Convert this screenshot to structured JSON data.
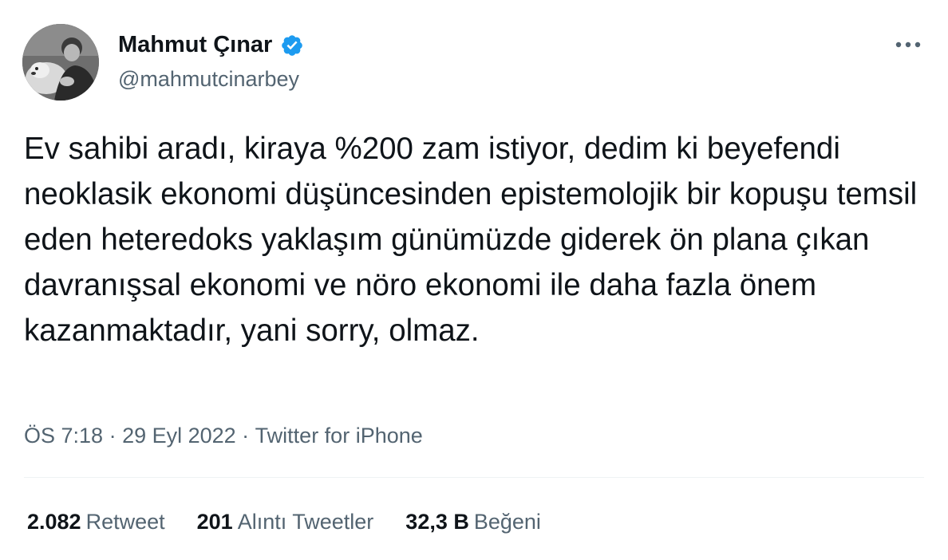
{
  "author": {
    "display_name": "Mahmut Çınar",
    "handle": "@mahmutcinarbey",
    "verified_icon": "verified-badge-icon",
    "avatar": "profile-photo-with-dog"
  },
  "more_icon": "more-horizontal-icon",
  "tweet": {
    "text": "Ev sahibi aradı, kiraya %200 zam istiyor, dedim ki beyefendi neoklasik ekonomi düşüncesinden epistemolojik bir kopuşu temsil eden heteredoks yaklaşım günümüzde giderek ön plana çıkan davranışsal ekonomi ve nöro ekonomi ile daha fazla önem kazanmaktadır, yani sorry, olmaz."
  },
  "meta": {
    "time": "ÖS 7:18",
    "separator_1": " · ",
    "date": "29 Eyl 2022",
    "separator_2": " · ",
    "source": "Twitter for iPhone"
  },
  "stats": [
    {
      "count": "2.082",
      "label": "Retweet"
    },
    {
      "count": "201",
      "label": "Alıntı Tweetler"
    },
    {
      "count": "32,3 B",
      "label": "Beğeni"
    }
  ],
  "colors": {
    "text_primary": "#0f1419",
    "text_secondary": "#536471",
    "verified_blue": "#1d9bf0",
    "divider": "#eff3f4"
  }
}
